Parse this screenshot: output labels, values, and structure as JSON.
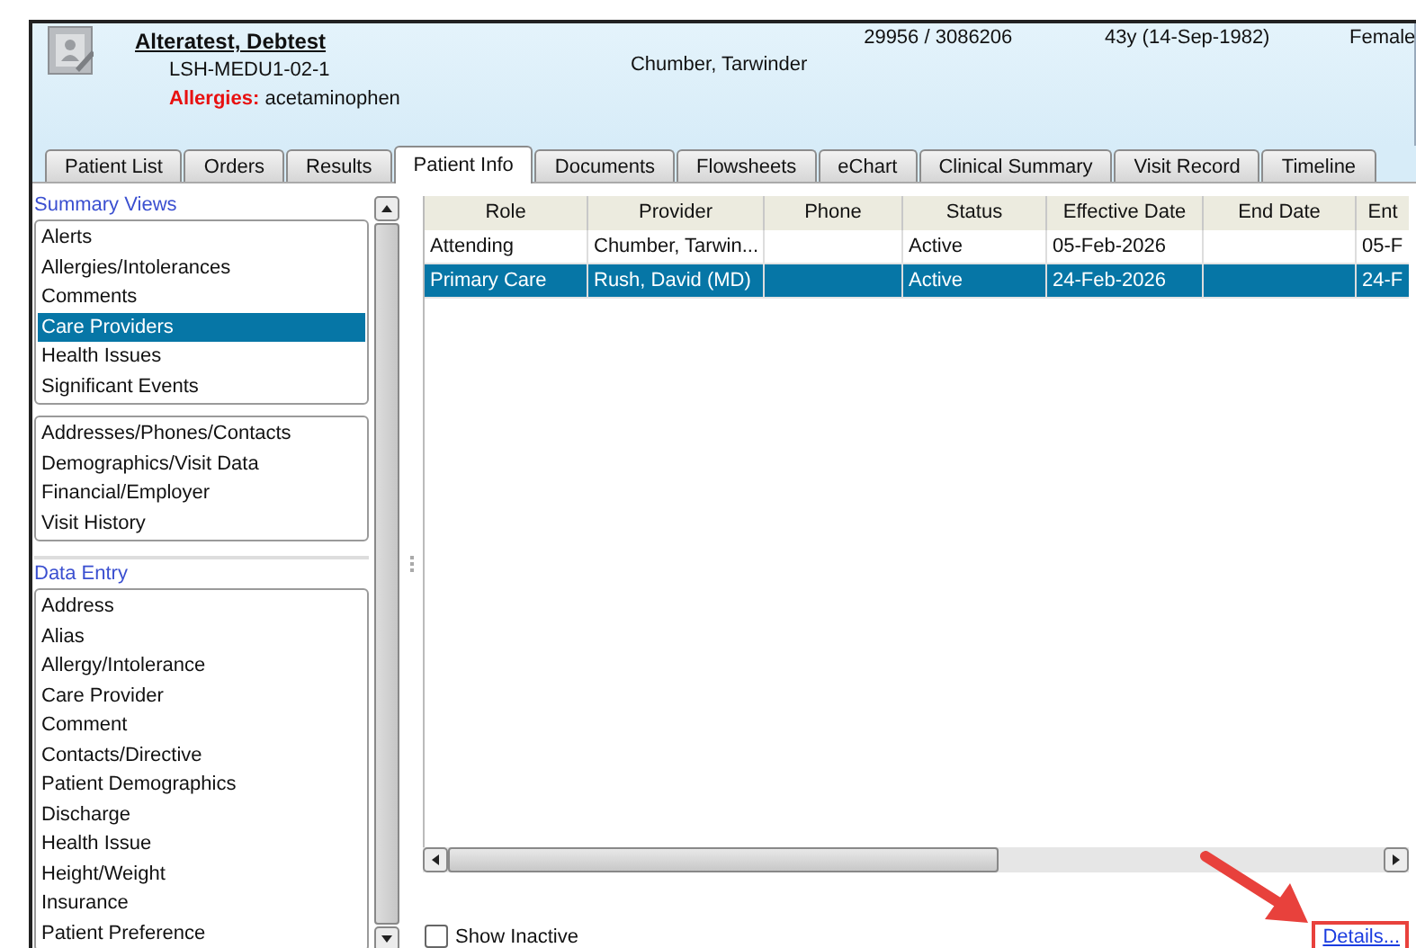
{
  "patient": {
    "name": "Alteratest, Debtest",
    "mrn": "LSH-MEDU1-02-1",
    "allergies_label": "Allergies:",
    "allergies": "acetaminophen",
    "ids": "29956 / 3086206",
    "attending": "Chumber, Tarwinder",
    "age": "43y (14-Sep-1982)",
    "sex": "Female"
  },
  "tabs": [
    {
      "label": "Patient List",
      "selected": false
    },
    {
      "label": "Orders",
      "selected": false
    },
    {
      "label": "Results",
      "selected": false
    },
    {
      "label": "Patient Info",
      "selected": true
    },
    {
      "label": "Documents",
      "selected": false
    },
    {
      "label": "Flowsheets",
      "selected": false
    },
    {
      "label": "eChart",
      "selected": false
    },
    {
      "label": "Clinical Summary",
      "selected": false
    },
    {
      "label": "Visit Record",
      "selected": false
    },
    {
      "label": "Timeline",
      "selected": false
    }
  ],
  "sidebar": {
    "summary_title": "Summary Views",
    "summary_items": [
      {
        "label": "Alerts",
        "selected": false
      },
      {
        "label": "Allergies/Intolerances",
        "selected": false
      },
      {
        "label": "Comments",
        "selected": false
      },
      {
        "label": "Care Providers",
        "selected": true
      },
      {
        "label": "Health Issues",
        "selected": false
      },
      {
        "label": "Significant Events",
        "selected": false
      }
    ],
    "other_items": [
      {
        "label": "Addresses/Phones/Contacts",
        "selected": false
      },
      {
        "label": "Demographics/Visit Data",
        "selected": false
      },
      {
        "label": "Financial/Employer",
        "selected": false
      },
      {
        "label": "Visit History",
        "selected": false
      }
    ],
    "entry_title": "Data Entry",
    "entry_items": [
      {
        "label": "Address",
        "selected": false
      },
      {
        "label": "Alias",
        "selected": false
      },
      {
        "label": "Allergy/Intolerance",
        "selected": false
      },
      {
        "label": "Care Provider",
        "selected": false
      },
      {
        "label": "Comment",
        "selected": false
      },
      {
        "label": "Contacts/Directive",
        "selected": false
      },
      {
        "label": "Patient Demographics",
        "selected": false
      },
      {
        "label": "Discharge",
        "selected": false
      },
      {
        "label": "Health Issue",
        "selected": false
      },
      {
        "label": "Height/Weight",
        "selected": false
      },
      {
        "label": "Insurance",
        "selected": false
      },
      {
        "label": "Patient Preference",
        "selected": false
      }
    ]
  },
  "table": {
    "columns": [
      "Role",
      "Provider",
      "Phone",
      "Status",
      "Effective Date",
      "End Date",
      "Ent"
    ],
    "rows": [
      {
        "cells": [
          "Attending",
          "Chumber, Tarwin...",
          "",
          "Active",
          "05-Feb-2026",
          "",
          "05-F"
        ],
        "selected": false
      },
      {
        "cells": [
          "Primary Care",
          "Rush, David (MD)",
          "",
          "Active",
          "24-Feb-2026",
          "",
          "24-F"
        ],
        "selected": true
      }
    ]
  },
  "show_inactive": {
    "label": "Show Inactive",
    "checked": false
  },
  "details_link": "Details..."
}
